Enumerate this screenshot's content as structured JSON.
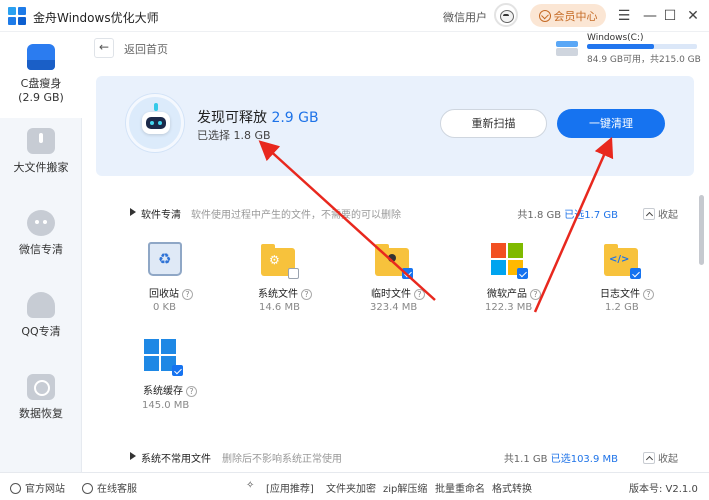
{
  "app": {
    "title": "金舟Windows优化大师",
    "user_name": "微信用户",
    "vip_label": "会员中心",
    "controls": [
      "☰",
      "—",
      "☐",
      "✕"
    ]
  },
  "sidebar": {
    "items": [
      {
        "label": "C盘瘦身",
        "sub": "(2.9 GB)",
        "icon": "drive-icon",
        "active": true
      },
      {
        "label": "大文件搬家",
        "icon": "box-icon",
        "active": false
      },
      {
        "label": "微信专清",
        "icon": "wechat-icon",
        "active": false
      },
      {
        "label": "QQ专清",
        "icon": "qq-icon",
        "active": false
      },
      {
        "label": "数据恢复",
        "icon": "recover-icon",
        "active": false
      }
    ]
  },
  "header": {
    "back_label": "返回首页",
    "drive_name": "Windows(C:)",
    "drive_info": "84.9 GB可用，共215.0 GB",
    "drive_used_fraction": 0.605
  },
  "banner": {
    "found_prefix": "发现可释放",
    "found_size": "2.9 GB",
    "selected": "已选择 1.8 GB",
    "rescan": "重新扫描",
    "clean": "一键清理"
  },
  "sections": [
    {
      "title": "软件专清",
      "desc": "软件使用过程中产生的文件，不需要的可以删除",
      "total": "共1.8 GB",
      "selected": "已选1.7 GB",
      "collapse": "收起",
      "items": [
        {
          "label": "回收站",
          "size": "0 KB",
          "icon": "recycle-bin-icon",
          "checked": null
        },
        {
          "label": "系统文件",
          "size": "14.6 MB",
          "icon": "system-files-icon",
          "checked": false
        },
        {
          "label": "临时文件",
          "size": "323.4 MB",
          "icon": "temp-files-icon",
          "checked": true
        },
        {
          "label": "微软产品",
          "size": "122.3 MB",
          "icon": "microsoft-icon",
          "checked": true
        },
        {
          "label": "日志文件",
          "size": "1.2 GB",
          "icon": "log-files-icon",
          "checked": true
        },
        {
          "label": "系统缓存",
          "size": "145.0 MB",
          "icon": "system-cache-icon",
          "checked": true
        }
      ]
    },
    {
      "title": "系统不常用文件",
      "desc": "删除后不影响系统正常使用",
      "total": "共1.1 GB",
      "selected": "已选103.9 MB",
      "collapse": "收起"
    }
  ],
  "footer": {
    "website": "官方网站",
    "service": "在线客服",
    "recommend": "[应用推荐]",
    "links": [
      "文件夹加密",
      "zip解压缩",
      "批量重命名",
      "格式转换"
    ],
    "version": "版本号: V2.1.0"
  },
  "colors": {
    "accent": "#1673f0",
    "vip": "#c56a25",
    "annotation_arrows": "#e8281e"
  }
}
